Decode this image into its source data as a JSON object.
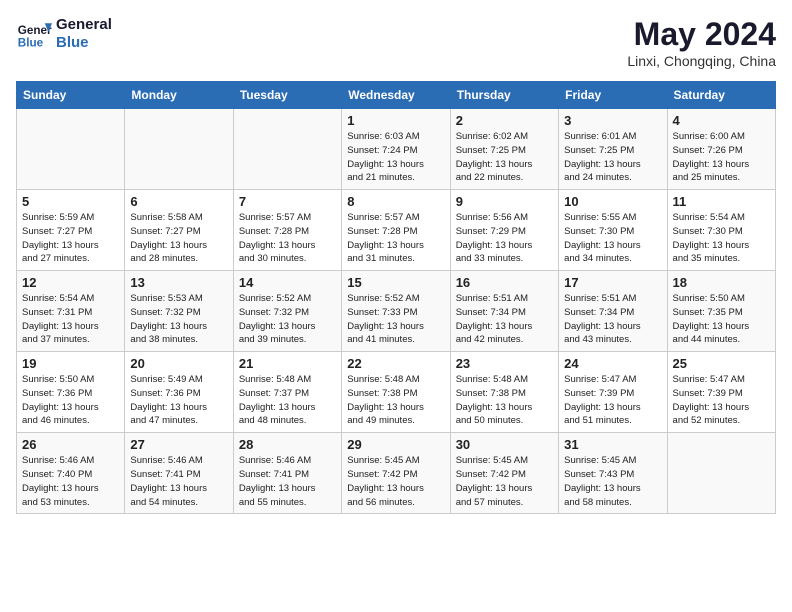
{
  "header": {
    "logo_line1": "General",
    "logo_line2": "Blue",
    "title": "May 2024",
    "subtitle": "Linxi, Chongqing, China"
  },
  "days_of_week": [
    "Sunday",
    "Monday",
    "Tuesday",
    "Wednesday",
    "Thursday",
    "Friday",
    "Saturday"
  ],
  "weeks": [
    [
      {
        "day": "",
        "info": ""
      },
      {
        "day": "",
        "info": ""
      },
      {
        "day": "",
        "info": ""
      },
      {
        "day": "1",
        "info": "Sunrise: 6:03 AM\nSunset: 7:24 PM\nDaylight: 13 hours\nand 21 minutes."
      },
      {
        "day": "2",
        "info": "Sunrise: 6:02 AM\nSunset: 7:25 PM\nDaylight: 13 hours\nand 22 minutes."
      },
      {
        "day": "3",
        "info": "Sunrise: 6:01 AM\nSunset: 7:25 PM\nDaylight: 13 hours\nand 24 minutes."
      },
      {
        "day": "4",
        "info": "Sunrise: 6:00 AM\nSunset: 7:26 PM\nDaylight: 13 hours\nand 25 minutes."
      }
    ],
    [
      {
        "day": "5",
        "info": "Sunrise: 5:59 AM\nSunset: 7:27 PM\nDaylight: 13 hours\nand 27 minutes."
      },
      {
        "day": "6",
        "info": "Sunrise: 5:58 AM\nSunset: 7:27 PM\nDaylight: 13 hours\nand 28 minutes."
      },
      {
        "day": "7",
        "info": "Sunrise: 5:57 AM\nSunset: 7:28 PM\nDaylight: 13 hours\nand 30 minutes."
      },
      {
        "day": "8",
        "info": "Sunrise: 5:57 AM\nSunset: 7:28 PM\nDaylight: 13 hours\nand 31 minutes."
      },
      {
        "day": "9",
        "info": "Sunrise: 5:56 AM\nSunset: 7:29 PM\nDaylight: 13 hours\nand 33 minutes."
      },
      {
        "day": "10",
        "info": "Sunrise: 5:55 AM\nSunset: 7:30 PM\nDaylight: 13 hours\nand 34 minutes."
      },
      {
        "day": "11",
        "info": "Sunrise: 5:54 AM\nSunset: 7:30 PM\nDaylight: 13 hours\nand 35 minutes."
      }
    ],
    [
      {
        "day": "12",
        "info": "Sunrise: 5:54 AM\nSunset: 7:31 PM\nDaylight: 13 hours\nand 37 minutes."
      },
      {
        "day": "13",
        "info": "Sunrise: 5:53 AM\nSunset: 7:32 PM\nDaylight: 13 hours\nand 38 minutes."
      },
      {
        "day": "14",
        "info": "Sunrise: 5:52 AM\nSunset: 7:32 PM\nDaylight: 13 hours\nand 39 minutes."
      },
      {
        "day": "15",
        "info": "Sunrise: 5:52 AM\nSunset: 7:33 PM\nDaylight: 13 hours\nand 41 minutes."
      },
      {
        "day": "16",
        "info": "Sunrise: 5:51 AM\nSunset: 7:34 PM\nDaylight: 13 hours\nand 42 minutes."
      },
      {
        "day": "17",
        "info": "Sunrise: 5:51 AM\nSunset: 7:34 PM\nDaylight: 13 hours\nand 43 minutes."
      },
      {
        "day": "18",
        "info": "Sunrise: 5:50 AM\nSunset: 7:35 PM\nDaylight: 13 hours\nand 44 minutes."
      }
    ],
    [
      {
        "day": "19",
        "info": "Sunrise: 5:50 AM\nSunset: 7:36 PM\nDaylight: 13 hours\nand 46 minutes."
      },
      {
        "day": "20",
        "info": "Sunrise: 5:49 AM\nSunset: 7:36 PM\nDaylight: 13 hours\nand 47 minutes."
      },
      {
        "day": "21",
        "info": "Sunrise: 5:48 AM\nSunset: 7:37 PM\nDaylight: 13 hours\nand 48 minutes."
      },
      {
        "day": "22",
        "info": "Sunrise: 5:48 AM\nSunset: 7:38 PM\nDaylight: 13 hours\nand 49 minutes."
      },
      {
        "day": "23",
        "info": "Sunrise: 5:48 AM\nSunset: 7:38 PM\nDaylight: 13 hours\nand 50 minutes."
      },
      {
        "day": "24",
        "info": "Sunrise: 5:47 AM\nSunset: 7:39 PM\nDaylight: 13 hours\nand 51 minutes."
      },
      {
        "day": "25",
        "info": "Sunrise: 5:47 AM\nSunset: 7:39 PM\nDaylight: 13 hours\nand 52 minutes."
      }
    ],
    [
      {
        "day": "26",
        "info": "Sunrise: 5:46 AM\nSunset: 7:40 PM\nDaylight: 13 hours\nand 53 minutes."
      },
      {
        "day": "27",
        "info": "Sunrise: 5:46 AM\nSunset: 7:41 PM\nDaylight: 13 hours\nand 54 minutes."
      },
      {
        "day": "28",
        "info": "Sunrise: 5:46 AM\nSunset: 7:41 PM\nDaylight: 13 hours\nand 55 minutes."
      },
      {
        "day": "29",
        "info": "Sunrise: 5:45 AM\nSunset: 7:42 PM\nDaylight: 13 hours\nand 56 minutes."
      },
      {
        "day": "30",
        "info": "Sunrise: 5:45 AM\nSunset: 7:42 PM\nDaylight: 13 hours\nand 57 minutes."
      },
      {
        "day": "31",
        "info": "Sunrise: 5:45 AM\nSunset: 7:43 PM\nDaylight: 13 hours\nand 58 minutes."
      },
      {
        "day": "",
        "info": ""
      }
    ]
  ]
}
